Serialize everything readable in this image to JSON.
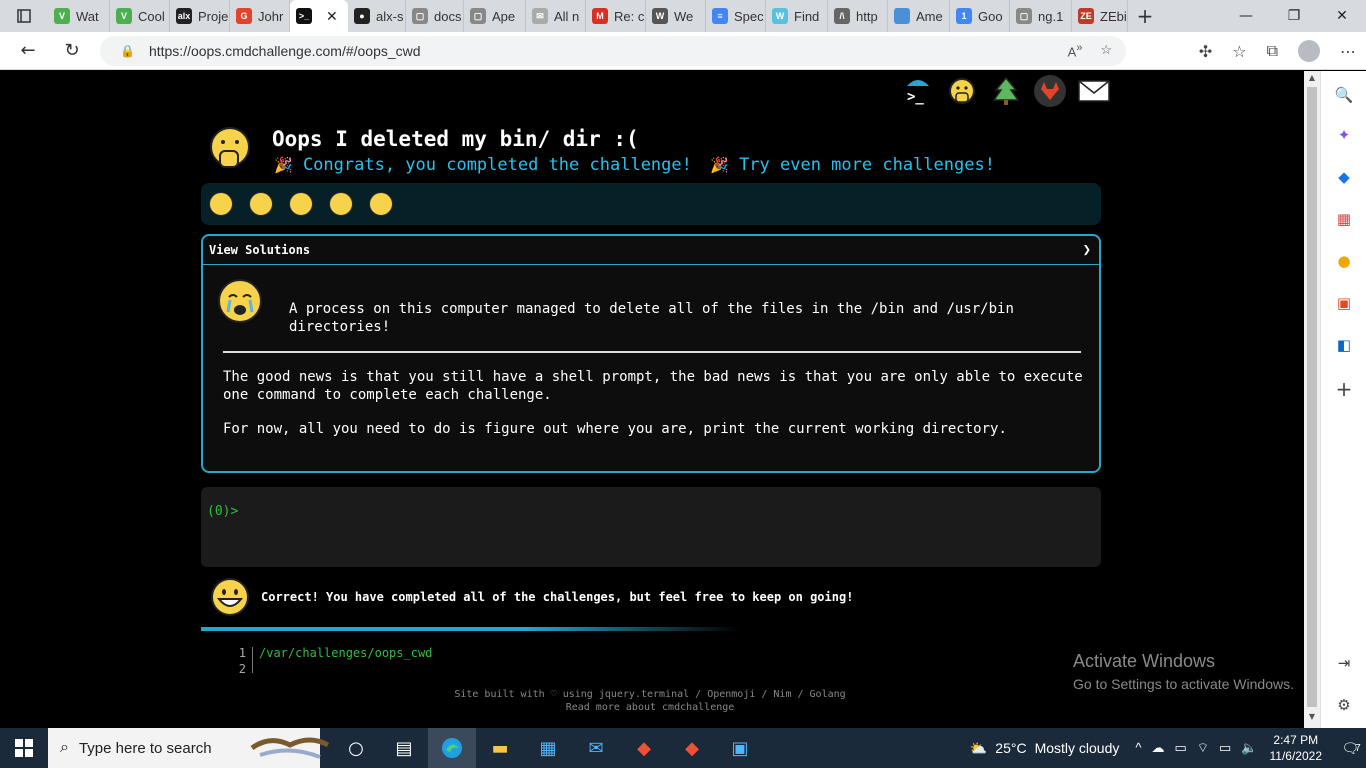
{
  "browser": {
    "tabs": [
      {
        "label": "Wat",
        "fav_color": "#4caf50",
        "fav_text": "V"
      },
      {
        "label": "Cool",
        "fav_color": "#4caf50",
        "fav_text": "V"
      },
      {
        "label": "Proje",
        "fav_color": "#222222",
        "fav_text": "alx"
      },
      {
        "label": "Johr",
        "fav_color": "#e24329",
        "fav_text": "G"
      },
      {
        "label": "",
        "fav_color": "#111111",
        "fav_text": ">_"
      },
      {
        "label": "alx-s",
        "fav_color": "#222222",
        "fav_text": "●"
      },
      {
        "label": "docs",
        "fav_color": "#888888",
        "fav_text": "▢"
      },
      {
        "label": "Ape",
        "fav_color": "#888888",
        "fav_text": "▢"
      },
      {
        "label": "All n",
        "fav_color": "#aaaaaa",
        "fav_text": "✉"
      },
      {
        "label": "Re: c",
        "fav_color": "#d93025",
        "fav_text": "M"
      },
      {
        "label": "We",
        "fav_color": "#555555",
        "fav_text": "W"
      },
      {
        "label": "Spec",
        "fav_color": "#4285f4",
        "fav_text": "≡"
      },
      {
        "label": "Find",
        "fav_color": "#5bc0de",
        "fav_text": "W"
      },
      {
        "label": "http",
        "fav_color": "#666666",
        "fav_text": "/\\"
      },
      {
        "label": "Ame",
        "fav_color": "#4a90d9",
        "fav_text": ""
      },
      {
        "label": "Goo",
        "fav_color": "#4285f4",
        "fav_text": "1"
      },
      {
        "label": "ng.1",
        "fav_color": "#888888",
        "fav_text": "▢"
      },
      {
        "label": "ZEbi",
        "fav_color": "#c0392b",
        "fav_text": "ZE"
      }
    ],
    "active_tab_close": "✕",
    "new_tab": "+",
    "url": "https://oops.cmdchallenge.com/#/oops_cwd",
    "window_controls": [
      "—",
      "❐",
      "✕"
    ]
  },
  "page": {
    "title": "Oops I deleted my bin/ dir :(",
    "congrats_emoji": "🎉",
    "congrats_text": "Congrats, you completed the challenge!",
    "more_emoji": "🎉",
    "more_text": "Try even more challenges!",
    "solutions_header": "View Solutions",
    "solutions_chevron": "❯",
    "intro": "A process on this computer managed to delete all of the files in the /bin and /usr/bin directories!",
    "para_good_news": "The good news is that you still have a shell prompt, the bad news is that you are only able to execute one command to complete each challenge.",
    "para_for_now": "For now, all you need to do is figure out where you are, print the current working directory.",
    "prompt": "(0)>",
    "result_message": "Correct! You have completed all of the challenges, but feel free to keep on going!",
    "editor": {
      "lines": [
        {
          "num": "1",
          "code": "/var/challenges/oops_cwd"
        },
        {
          "num": "2",
          "code": ""
        }
      ]
    },
    "footer_line1": "Site built with ♡ using jquery.terminal / Openmoji / Nim / Golang",
    "footer_line2": "Read more about cmdchallenge"
  },
  "watermark": {
    "line1": "Activate Windows",
    "line2": "Go to Settings to activate Windows."
  },
  "taskbar": {
    "search_placeholder": "Type here to search",
    "weather_temp": "25°C",
    "weather_desc": "Mostly cloudy",
    "time": "2:47 PM",
    "date": "11/6/2022",
    "notification_count": "7"
  }
}
